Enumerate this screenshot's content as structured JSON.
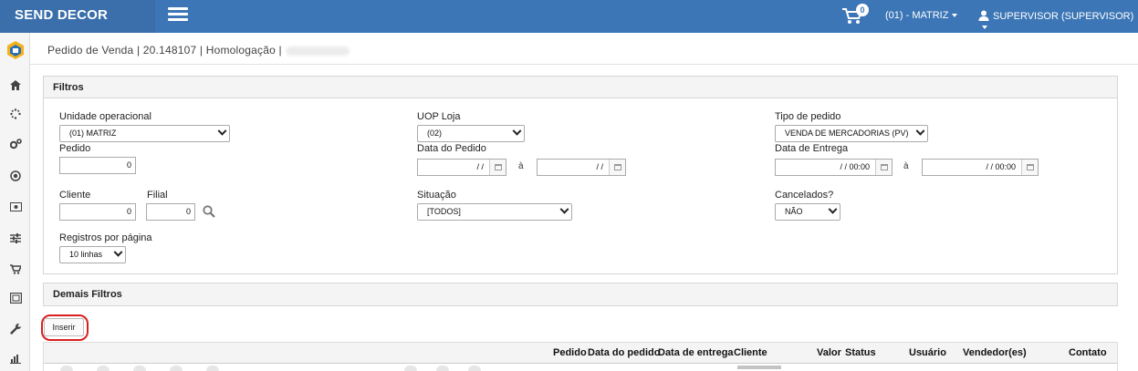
{
  "header": {
    "brand": "SEND DECOR",
    "cart_count": "0",
    "branch": "(01) - MATRIZ",
    "user": "SUPERVISOR (SUPERVISOR)"
  },
  "sidebar": {
    "items": [
      "logo",
      "home-icon",
      "spinner-icon",
      "settings-icon",
      "target-icon",
      "money-icon",
      "sliders-icon",
      "cart-icon",
      "picture-icon",
      "wrench-icon",
      "bar-chart-icon"
    ]
  },
  "breadcrumb": "Pedido de Venda | 20.148107 | Homologação |",
  "filters": {
    "title": "Filtros",
    "unidade_label": "Unidade operacional",
    "unidade_value": "(01) MATRIZ",
    "uop_label": "UOP Loja",
    "uop_value": "(02)",
    "tipo_label": "Tipo de pedido",
    "tipo_value": "VENDA DE MERCADORIAS (PV)",
    "pedido_label": "Pedido",
    "pedido_value": "0",
    "data_pedido_label": "Data do Pedido",
    "data_pedido_from": "/ /",
    "data_pedido_to": "/ /",
    "a_separator": "à",
    "data_entrega_label": "Data de Entrega",
    "data_entrega_from": "/ /    00:00",
    "data_entrega_to": "/ /    00:00",
    "cliente_label": "Cliente",
    "cliente_value": "0",
    "filial_label": "Filial",
    "filial_value": "0",
    "situacao_label": "Situação",
    "situacao_value": "[TODOS]",
    "cancelados_label": "Cancelados?",
    "cancelados_value": "NÃO",
    "registros_label": "Registros por página",
    "registros_value": "10 linhas"
  },
  "more_filters": {
    "title": "Demais Filtros"
  },
  "actions": {
    "insert_label": "Inserir"
  },
  "table": {
    "columns": [
      "Pedido",
      "Data do pedido",
      "Data de entrega",
      "Cliente",
      "Valor",
      "Status",
      "Usuário",
      "Vendedor(es)",
      "Contato"
    ]
  },
  "colors": {
    "topbar": "#3c76b6",
    "highlight": "#d9201f"
  }
}
